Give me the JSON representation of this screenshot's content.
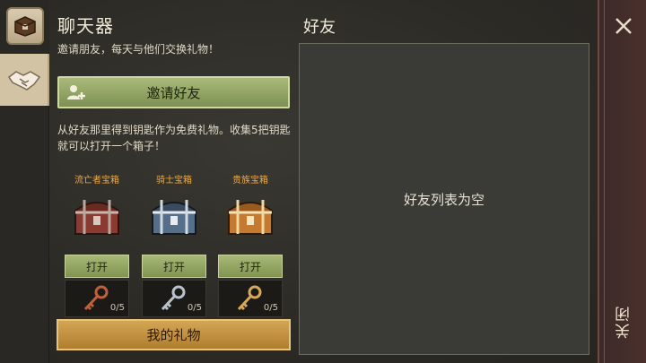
{
  "header": {
    "title": "聊天器",
    "subtitle": "邀请朋友，每天与他们交换礼物！"
  },
  "tabs": [
    {
      "icon": "chest-badge-icon"
    },
    {
      "icon": "handshake-icon"
    }
  ],
  "invite": {
    "label": "邀请好友",
    "icon": "add-user-icon"
  },
  "description": "从好友那里得到钥匙作为免费礼物。收集5把钥匙就可以打开一个箱子！",
  "chests": [
    {
      "name": "流亡者宝箱",
      "open_label": "打开",
      "keys": "0/5",
      "color": "#b4483a",
      "key_color": "#c0603a"
    },
    {
      "name": "骑士宝箱",
      "open_label": "打开",
      "keys": "0/5",
      "color": "#6f8fb0",
      "key_color": "#b8c2cc"
    },
    {
      "name": "贵族宝箱",
      "open_label": "打开",
      "keys": "0/5",
      "color": "#d28a3a",
      "key_color": "#d7a85a"
    }
  ],
  "gift_button": {
    "label": "我的礼物"
  },
  "friends": {
    "title": "好友",
    "empty_text": "好友列表为空"
  },
  "close": {
    "label": "关闭",
    "icon": "close-icon"
  },
  "colors": {
    "accent_green": "#8fa25d",
    "accent_gold": "#c4923f",
    "chest_title": "#f0a840"
  }
}
